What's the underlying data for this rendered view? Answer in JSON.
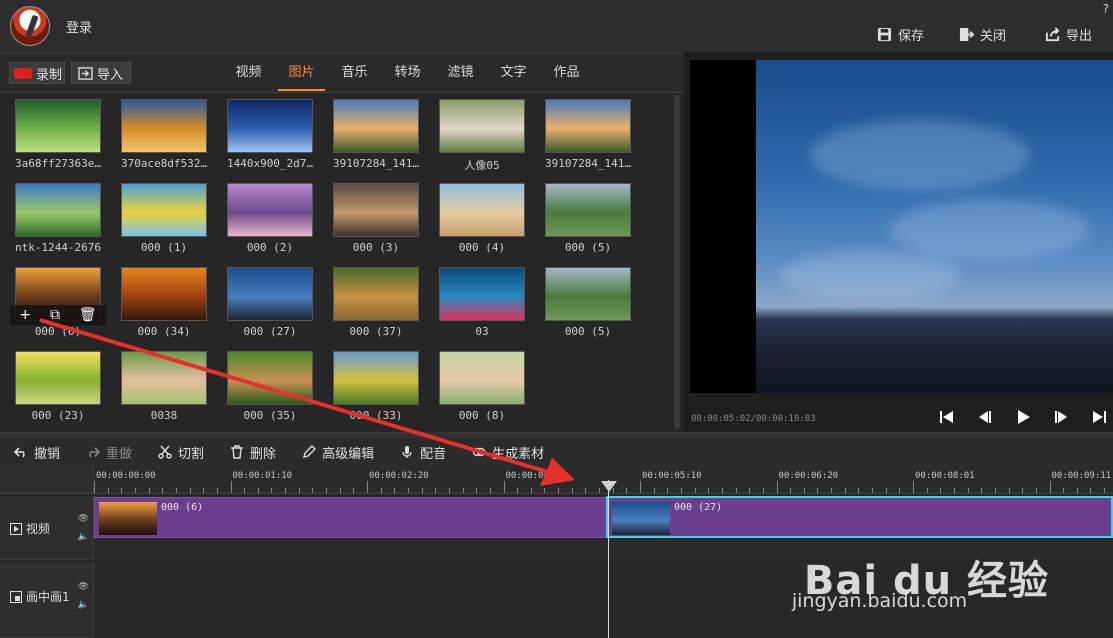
{
  "titlebar": {
    "login": "登录",
    "help": "?",
    "save": "保存",
    "close": "关闭",
    "export": "导出"
  },
  "library": {
    "record_label": "录制",
    "import_label": "导入",
    "tabs": [
      "视频",
      "图片",
      "音乐",
      "转场",
      "滤镜",
      "文字",
      "作品"
    ],
    "active_tab": "图片",
    "items": [
      {
        "label": "3a68ff27363e…",
        "colors": [
          "#1f5e2a",
          "#6fb24a",
          "#bfe07e"
        ]
      },
      {
        "label": "370ace8df532…",
        "colors": [
          "#2a5b9c",
          "#d88c2c",
          "#f3c36b"
        ]
      },
      {
        "label": "1440x900_2d7…",
        "colors": [
          "#0d2866",
          "#2f5fb0",
          "#9ec3f0"
        ]
      },
      {
        "label": "39107284_141…",
        "colors": [
          "#4a7cc0",
          "#e9b068",
          "#3a5a2b"
        ]
      },
      {
        "label": "人像05",
        "colors": [
          "#8aa06a",
          "#e4d6c8",
          "#5f7a40"
        ]
      },
      {
        "label": "39107284_141…",
        "colors": [
          "#4a7cc0",
          "#e9b068",
          "#3a5a2b"
        ]
      },
      {
        "label": "ntk-1244-2676",
        "colors": [
          "#3c7bc4",
          "#9bc76a",
          "#2c6a2a"
        ]
      },
      {
        "label": "000 (1)",
        "colors": [
          "#4fa0d8",
          "#e8d43a",
          "#7cc0e6"
        ]
      },
      {
        "label": "000 (2)",
        "colors": [
          "#b68ad0",
          "#6a4a8a",
          "#e8b6c8"
        ]
      },
      {
        "label": "000 (3)",
        "colors": [
          "#5a4a44",
          "#c69a6a",
          "#3a3230"
        ]
      },
      {
        "label": "000 (4)",
        "colors": [
          "#8fbfe0",
          "#e6cba0",
          "#c9a070"
        ]
      },
      {
        "label": "000 (5)",
        "colors": [
          "#a0b8c8",
          "#4a7a3a",
          "#6e9a5a"
        ]
      },
      {
        "label": "000 (6)",
        "colors": [
          "#f0a040",
          "#6a3a1a",
          "#1a1010"
        ]
      },
      {
        "label": "000 (34)",
        "colors": [
          "#e8841a",
          "#a04010",
          "#301808"
        ]
      },
      {
        "label": "000 (27)",
        "colors": [
          "#1a4c8c",
          "#4a80c0",
          "#1c2436"
        ]
      },
      {
        "label": "000 (37)",
        "colors": [
          "#4a6a2a",
          "#c89040",
          "#8a6a30"
        ]
      },
      {
        "label": "03",
        "colors": [
          "#0a4a7a",
          "#2a8ac0",
          "#e03060"
        ]
      },
      {
        "label": "000 (5)",
        "colors": [
          "#a0b8c8",
          "#4a7a3a",
          "#6e9a5a"
        ]
      },
      {
        "label": "000 (23)",
        "colors": [
          "#f0e060",
          "#8ab030",
          "#c8d880"
        ]
      },
      {
        "label": "0038",
        "colors": [
          "#6a9a4a",
          "#e8c0a0",
          "#a0c070"
        ]
      },
      {
        "label": "000 (35)",
        "colors": [
          "#4a8a2a",
          "#c89050",
          "#2a5a1a"
        ]
      },
      {
        "label": "000 (33)",
        "colors": [
          "#6a9ad0",
          "#d8c040",
          "#4a7a2a"
        ]
      },
      {
        "label": "000 (8)",
        "colors": [
          "#c0d8a0",
          "#e8c8a8",
          "#8ab070"
        ]
      }
    ]
  },
  "preview": {
    "timecode": "00:00:05:02/00:00:10:03"
  },
  "edit_toolbar": {
    "undo": "撤销",
    "redo": "重做",
    "cut": "切割",
    "delete": "删除",
    "advanced": "高级编辑",
    "dub": "配音",
    "material": "生成素材"
  },
  "timeline": {
    "ruler_labels": [
      "00:00:00:00",
      "00:00:01:10",
      "00:00:02:20",
      "00:00:04:…",
      "00:00:05:10",
      "00:00:06:20",
      "00:00:08:01",
      "00:00:09:11"
    ],
    "tracks": [
      {
        "name": "视频"
      },
      {
        "name": "画中画1"
      }
    ],
    "clips": [
      {
        "label": "000 (6)",
        "colors": [
          "#f0a040",
          "#6a3a1a",
          "#1a1010"
        ]
      },
      {
        "label": "000 (27)",
        "colors": [
          "#1a4c8c",
          "#4a80c0",
          "#1c2436"
        ]
      }
    ]
  },
  "watermark": {
    "text": "Bai du 经验",
    "url": "jingyan.baidu.com"
  }
}
